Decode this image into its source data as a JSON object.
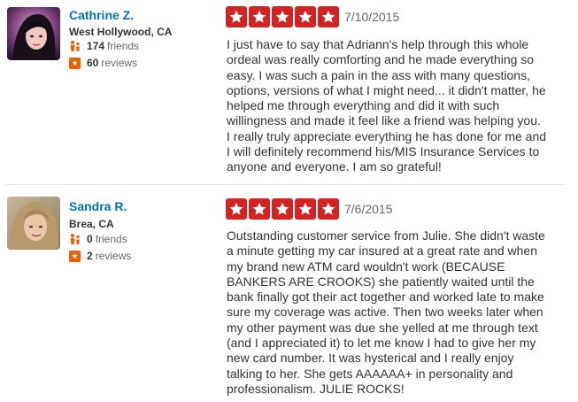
{
  "reviews": [
    {
      "user": {
        "name": "Cathrine Z.",
        "location": "West Hollywood, CA",
        "friends_count": "174",
        "friends_label": "friends",
        "reviews_count": "60",
        "reviews_label": "reviews"
      },
      "rating": 5,
      "date": "7/10/2015",
      "text_lines": [
        "I just have to say that Adriann's help through this whole",
        "ordeal was really comforting and he made everything so",
        "easy. I was such a pain in the ass with many questions,",
        "options, versions of what I might need... it didn't matter, he",
        "helped me through everything and did it with such",
        "willingness and made it feel like a friend was helping you.",
        "I really truly appreciate everything he has done for me and",
        "I will definitely recommend his/MIS Insurance Services to",
        "anyone and everyone.  I am so grateful!"
      ]
    },
    {
      "user": {
        "name": "Sandra R.",
        "location": "Brea, CA",
        "friends_count": "0",
        "friends_label": "friends",
        "reviews_count": "2",
        "reviews_label": "reviews"
      },
      "rating": 5,
      "date": "7/6/2015",
      "text_lines": [
        "Outstanding customer service from Julie. She didn't waste",
        "a minute getting my car insured at a great rate and when",
        "my brand new ATM card wouldn't work (BECAUSE",
        "BANKERS ARE CROOKS) she patiently waited until the",
        "bank finally got their act together and worked late to make",
        "sure my coverage was active. Then two weeks later when",
        "my other payment was due she yelled at me through text",
        "(and I appreciated it) to let me know I had to give her my",
        "new card number. It was hysterical and I really enjoy",
        "talking to her.  She gets AAAAAA+ in personality and",
        "professionalism. JULIE ROCKS!"
      ]
    }
  ],
  "colors": {
    "star_red": "#d32323",
    "link_blue": "#0073bb",
    "review_icon_orange": "#f15c00",
    "friends_icon_orange": "#f15c00"
  },
  "icons": {
    "star": "star-icon",
    "friends": "friends-icon",
    "reviews": "review-star-icon"
  }
}
